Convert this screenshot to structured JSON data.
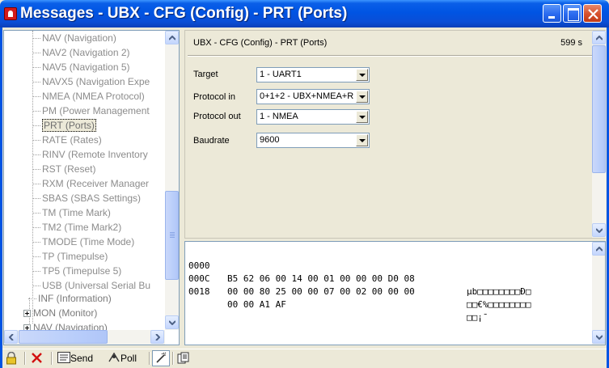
{
  "window": {
    "title": "Messages - UBX - CFG (Config) - PRT (Ports)"
  },
  "tree": {
    "items": [
      {
        "label": "NAV (Navigation)"
      },
      {
        "label": "NAV2 (Navigation 2)"
      },
      {
        "label": "NAV5 (Navigation 5)"
      },
      {
        "label": "NAVX5 (Navigation Expe"
      },
      {
        "label": "NMEA (NMEA Protocol)"
      },
      {
        "label": "PM (Power Management"
      },
      {
        "label": "PRT (Ports)",
        "selected": true
      },
      {
        "label": "RATE (Rates)"
      },
      {
        "label": "RINV (Remote Inventory"
      },
      {
        "label": "RST (Reset)"
      },
      {
        "label": "RXM (Receiver Manager"
      },
      {
        "label": "SBAS (SBAS Settings)"
      },
      {
        "label": "TM (Time Mark)"
      },
      {
        "label": "TM2 (Time Mark2)"
      },
      {
        "label": "TMODE (Time Mode)"
      },
      {
        "label": "TP (Timepulse)"
      },
      {
        "label": "TP5 (Timepulse 5)"
      },
      {
        "label": "USB (Universal Serial Bu"
      }
    ],
    "top_items": [
      {
        "label": "INF (Information)"
      },
      {
        "label": "MON (Monitor)"
      },
      {
        "label": "NAV (Navigation)"
      }
    ]
  },
  "panel": {
    "title": "UBX - CFG (Config) - PRT (Ports)",
    "age": "599 s",
    "fields": [
      {
        "label": "Target",
        "value": "1 - UART1"
      },
      {
        "label": "Protocol in",
        "value": "0+1+2 - UBX+NMEA+R"
      },
      {
        "label": "Protocol out",
        "value": "1 - NMEA"
      },
      {
        "label": "Baudrate",
        "value": "9600"
      }
    ]
  },
  "hex": {
    "rows": [
      {
        "addr": "0000",
        "bytes": "B5 62 06 00 14 00 01 00 00 00 D0 08",
        "ascii": "µb□□□□□□□□Ð□"
      },
      {
        "addr": "000C",
        "bytes": "00 00 80 25 00 00 07 00 02 00 00 00",
        "ascii": "□□€%□□□□□□□□"
      },
      {
        "addr": "0018",
        "bytes": "00 00 A1 AF",
        "ascii": "□□¡¯"
      }
    ]
  },
  "toolbar": {
    "send_label": "Send",
    "poll_label": "Poll"
  },
  "colors": {
    "titlebar": "#0054e3",
    "panel_bg": "#ece9d8",
    "close_button": "#d6502c"
  }
}
